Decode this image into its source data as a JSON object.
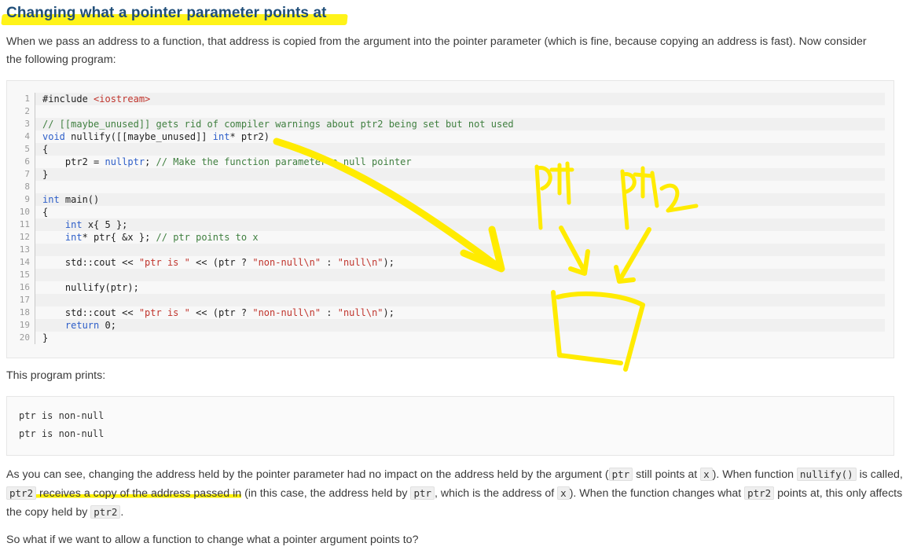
{
  "heading": "Changing what a pointer parameter points at",
  "intro_text": "When we pass an address to a function, that address is copied from the argument into the pointer parameter (which is fine, because copying an address is fast). Now consider the following program:",
  "code_lines": [
    {
      "n": "1",
      "parts": [
        [
          "",
          "#include "
        ],
        [
          "str",
          "<iostream>"
        ]
      ]
    },
    {
      "n": "2",
      "parts": []
    },
    {
      "n": "3",
      "parts": [
        [
          "cmt",
          "// [[maybe_unused]] gets rid of compiler warnings about ptr2 being set but not used"
        ]
      ]
    },
    {
      "n": "4",
      "parts": [
        [
          "kw",
          "void"
        ],
        [
          "",
          " nullify([[maybe_unused]] "
        ],
        [
          "kw",
          "int"
        ],
        [
          "",
          "* ptr2)"
        ]
      ]
    },
    {
      "n": "5",
      "parts": [
        [
          "",
          "{"
        ]
      ]
    },
    {
      "n": "6",
      "parts": [
        [
          "",
          "    ptr2 = "
        ],
        [
          "kw",
          "nullptr"
        ],
        [
          "",
          "; "
        ],
        [
          "cmt",
          "// Make the function parameter a null pointer"
        ]
      ]
    },
    {
      "n": "7",
      "parts": [
        [
          "",
          "}"
        ]
      ]
    },
    {
      "n": "8",
      "parts": []
    },
    {
      "n": "9",
      "parts": [
        [
          "kw",
          "int"
        ],
        [
          "",
          " main()"
        ]
      ]
    },
    {
      "n": "10",
      "parts": [
        [
          "",
          "{"
        ]
      ]
    },
    {
      "n": "11",
      "parts": [
        [
          "",
          "    "
        ],
        [
          "kw",
          "int"
        ],
        [
          "",
          " x{ 5 };"
        ]
      ]
    },
    {
      "n": "12",
      "parts": [
        [
          "",
          "    "
        ],
        [
          "kw",
          "int"
        ],
        [
          "",
          "* ptr{ &x }; "
        ],
        [
          "cmt",
          "// ptr points to x"
        ]
      ]
    },
    {
      "n": "13",
      "parts": []
    },
    {
      "n": "14",
      "parts": [
        [
          "",
          "    std::cout << "
        ],
        [
          "str",
          "\"ptr is \""
        ],
        [
          "",
          " << (ptr ? "
        ],
        [
          "str",
          "\"non-null\\n\""
        ],
        [
          "",
          " : "
        ],
        [
          "str",
          "\"null\\n\""
        ],
        [
          "",
          ");"
        ]
      ]
    },
    {
      "n": "15",
      "parts": []
    },
    {
      "n": "16",
      "parts": [
        [
          "",
          "    nullify(ptr);"
        ]
      ]
    },
    {
      "n": "17",
      "parts": []
    },
    {
      "n": "18",
      "parts": [
        [
          "",
          "    std::cout << "
        ],
        [
          "str",
          "\"ptr is \""
        ],
        [
          "",
          " << (ptr ? "
        ],
        [
          "str",
          "\"non-null\\n\""
        ],
        [
          "",
          " : "
        ],
        [
          "str",
          "\"null\\n\""
        ],
        [
          "",
          ");"
        ]
      ]
    },
    {
      "n": "19",
      "parts": [
        [
          "",
          "    "
        ],
        [
          "kw",
          "return"
        ],
        [
          "",
          " 0;"
        ]
      ]
    },
    {
      "n": "20",
      "parts": [
        [
          "",
          "}"
        ]
      ]
    }
  ],
  "output_intro": "This program prints:",
  "output_lines": [
    "ptr is non-null",
    "ptr is non-null"
  ],
  "para2": {
    "s1": "As you can see, changing the address held by the pointer parameter had no impact on the address held by the argument (",
    "c1": "ptr",
    "s2": " still points at ",
    "c2": "x",
    "s3": "). When function ",
    "c3": "nullify()",
    "s4": " is called, ",
    "c4": "ptr2",
    "h1": " receives a copy of the address passed in",
    "s5": " (in this case, the address held by ",
    "c5": "ptr",
    "s6": ", which is the address of ",
    "c6": "x",
    "s7": "). When the function changes what ",
    "c7": "ptr2",
    "s8": " points at, this only affects the copy held by ",
    "c8": "ptr2",
    "s9": "."
  },
  "para3": "So what if we want to allow a function to change what a pointer argument points to?",
  "annotation_color": "#ffeb00"
}
